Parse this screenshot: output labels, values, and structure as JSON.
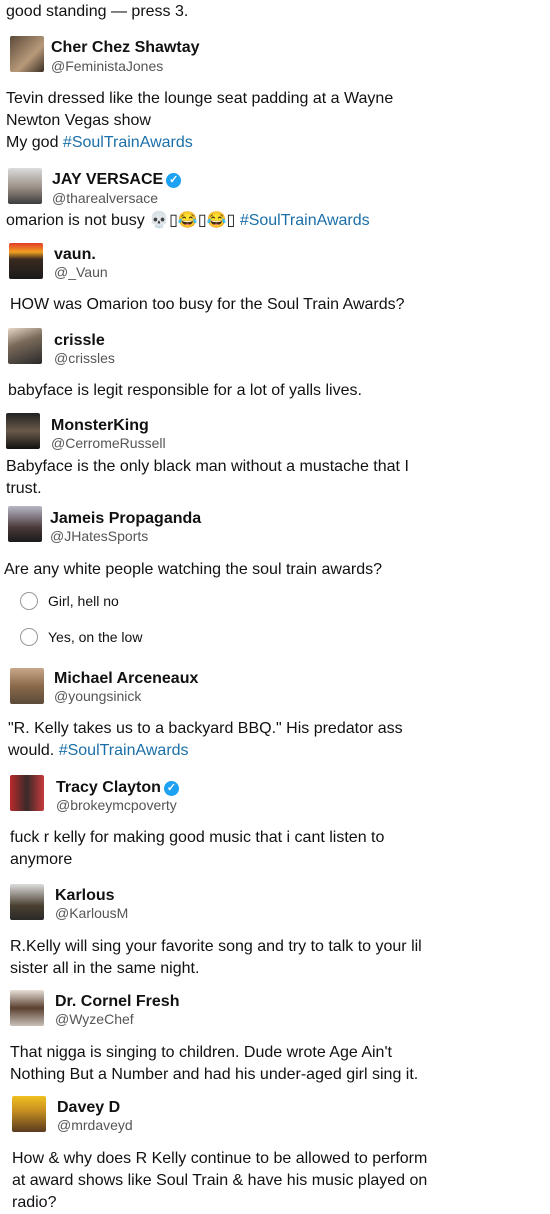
{
  "top": {
    "fragment": "good standing — press 3."
  },
  "tweets": [
    {
      "name": "Cher Chez Shawtay",
      "handle": "@FeministaJones",
      "text": "Tevin dressed like the lounge seat padding at a Wayne Newton Vegas show",
      "text2": "My god ",
      "hashtag": "#SoulTrainAwards"
    },
    {
      "name": "JAY VERSACE",
      "handle": "@tharealversace",
      "text": "omarion is not busy 💀▯😂▯😂▯ ",
      "hashtag": "#SoulTrainAwards"
    },
    {
      "name": "vaun.",
      "handle": "@_Vaun",
      "text": "HOW was Omarion too busy for the Soul Train Awards?"
    },
    {
      "name": "crissle",
      "handle": "@crissles",
      "text": "babyface is legit responsible for a lot of yalls lives."
    },
    {
      "name": "MonsterKing",
      "handle": "@CerromeRussell",
      "text": "Babyface is the only black man without a mustache that I trust."
    },
    {
      "name": "Jameis Propaganda",
      "handle": "@JHatesSports",
      "text": "Are any white people watching the soul train awards?",
      "poll": [
        "Girl, hell no",
        "Yes, on the low"
      ]
    },
    {
      "name": "Michael Arceneaux",
      "handle": "@youngsinick",
      "text": "\"R. Kelly takes us to a backyard BBQ.\" His predator ass would. ",
      "hashtag": "#SoulTrainAwards"
    },
    {
      "name": "Tracy Clayton",
      "handle": "@brokeymcpoverty",
      "text": "fuck r kelly for making good music that i cant listen to anymore"
    },
    {
      "name": "Karlous",
      "handle": "@KarlousM",
      "text": "R.Kelly will sing your favorite song and try to talk to your lil sister all in the same night."
    },
    {
      "name": "Dr. Cornel Fresh",
      "handle": "@WyzeChef",
      "text": "That nigga is singing to children. Dude wrote Age Ain't Nothing But a Number and had his under-aged girl sing it."
    },
    {
      "name": "Davey D",
      "handle": "@mrdaveyd",
      "text": "How & why does R Kelly continue to be allowed to perform at award shows like Soul Train & have his music played on radio?"
    }
  ],
  "colors": {
    "hashtag": "#1b6fa8",
    "verified": "#1da1f2"
  }
}
